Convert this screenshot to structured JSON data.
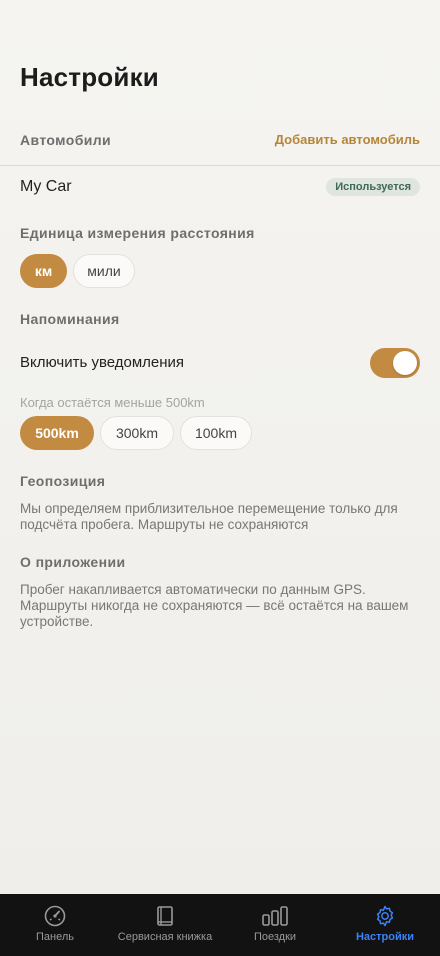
{
  "header": {
    "title": "Настройки"
  },
  "cars": {
    "section_label": "Автомобили",
    "add_label": "Добавить автомобиль",
    "items": [
      {
        "name": "My Car",
        "badge": "Используется"
      }
    ]
  },
  "units": {
    "section_label": "Единица измерения расстояния",
    "options": [
      {
        "label": "км",
        "selected": true
      },
      {
        "label": "мили",
        "selected": false
      }
    ]
  },
  "reminders": {
    "section_label": "Напоминания",
    "enable_label": "Включить уведомления",
    "enabled": true,
    "threshold_label": "Когда остаётся меньше 500km",
    "options": [
      {
        "label": "500km",
        "selected": true
      },
      {
        "label": "300km",
        "selected": false
      },
      {
        "label": "100km",
        "selected": false
      }
    ]
  },
  "geo": {
    "section_label": "Геопозиция",
    "text": "Мы определяем приблизительное перемещение только для подсчёта пробега. Маршруты не сохраняются"
  },
  "about": {
    "section_label": "О приложении",
    "text": "Пробег накапливается автоматически по данным GPS. Маршруты никогда не сохраняются — всё остаётся на вашем устройстве."
  },
  "tabs": [
    {
      "label": "Панель",
      "icon": "gauge-icon"
    },
    {
      "label": "Сервисная книжка",
      "icon": "book-icon"
    },
    {
      "label": "Поездки",
      "icon": "bars-icon"
    },
    {
      "label": "Настройки",
      "icon": "gear-icon",
      "active": true
    }
  ],
  "colors": {
    "accent": "#c38b42",
    "tab_active": "#3b82f6",
    "badge_bg": "#dfe5e0",
    "badge_text": "#3f6a55"
  }
}
